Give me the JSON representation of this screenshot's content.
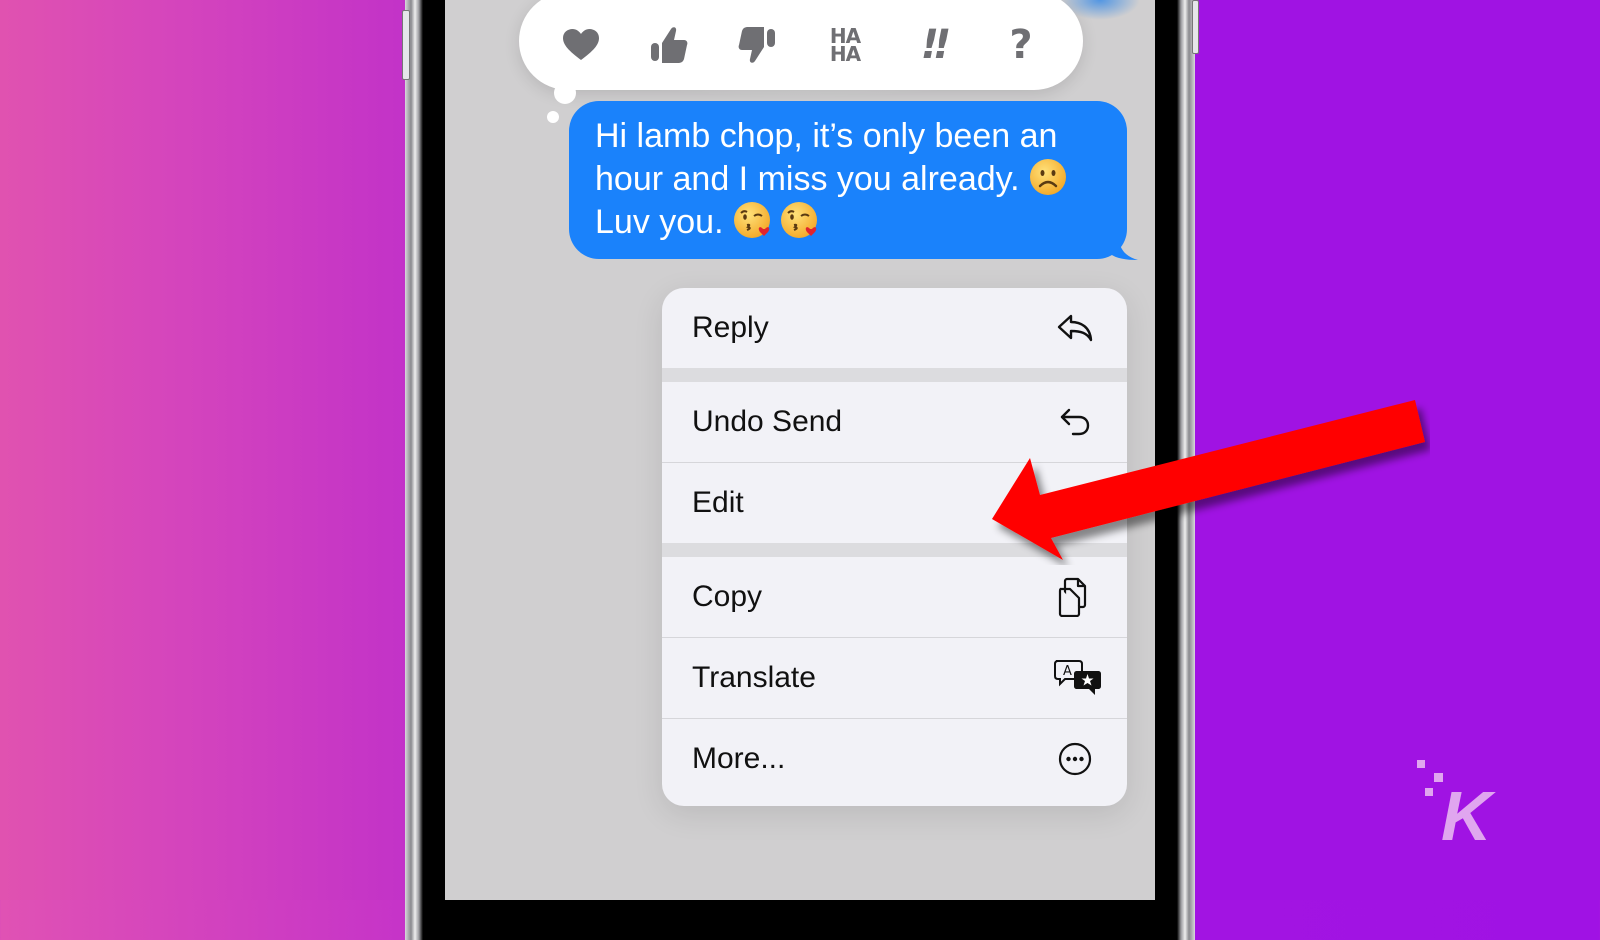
{
  "background": {
    "left_color": "#e052b4",
    "right_color": "#a013e3"
  },
  "tapback": {
    "reactions": [
      {
        "name": "heart",
        "icon": "heart-icon"
      },
      {
        "name": "thumbs-up",
        "icon": "thumbs-up-icon"
      },
      {
        "name": "thumbs-down",
        "icon": "thumbs-down-icon"
      },
      {
        "name": "haha",
        "icon": "haha-icon",
        "line1": "HA",
        "line2": "HA"
      },
      {
        "name": "emphasize",
        "icon": "double-exclamation-icon",
        "text": "!!"
      },
      {
        "name": "question",
        "icon": "question-mark-icon",
        "text": "?"
      }
    ],
    "icon_color": "#6f6f73"
  },
  "message": {
    "line1": "Hi lamb chop, it’s only been an",
    "line2": "hour and I miss you already.",
    "line3": "Luv you.",
    "emojis": [
      "slightly-frowning-face",
      "face-blowing-a-kiss",
      "face-blowing-a-kiss"
    ],
    "bubble_color": "#1a82fb"
  },
  "context_menu": {
    "items": [
      {
        "label": "Reply",
        "icon": "reply-icon"
      },
      {
        "label": "Undo Send",
        "icon": "undo-icon"
      },
      {
        "label": "Edit",
        "icon": ""
      },
      {
        "label": "Copy",
        "icon": "copy-icon"
      },
      {
        "label": "Translate",
        "icon": "translate-icon"
      },
      {
        "label": "More...",
        "icon": "more-ellipsis-icon"
      }
    ],
    "translate_icon_letter": "A"
  },
  "annotation": {
    "arrow_color": "#ff0000",
    "points_to": "Edit"
  },
  "watermark": {
    "letter": "K",
    "color": "#e0a6ef"
  }
}
